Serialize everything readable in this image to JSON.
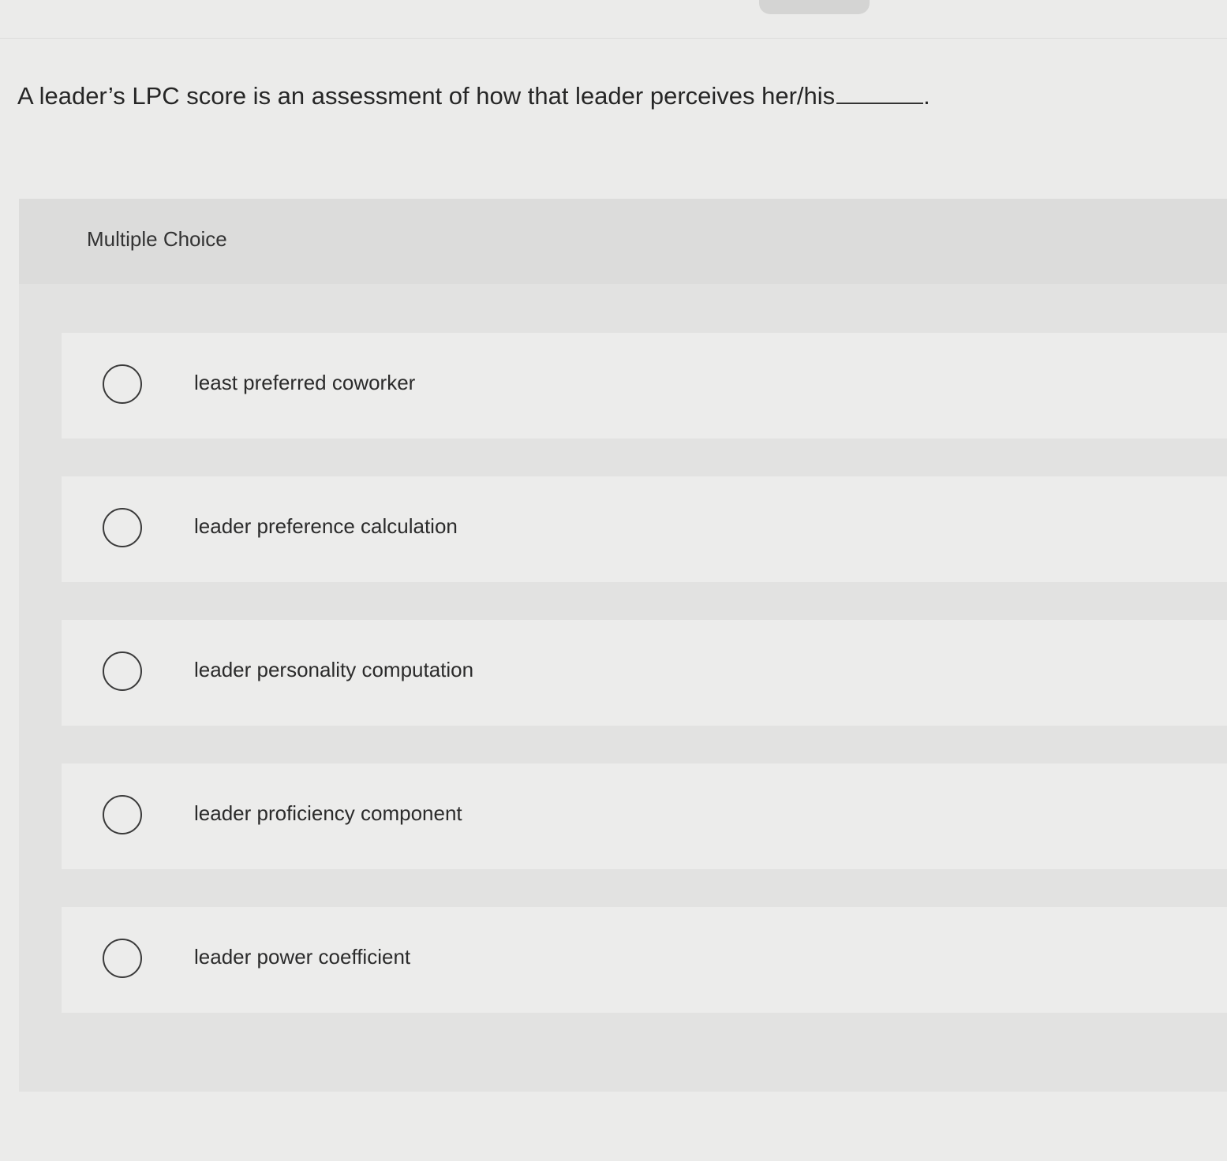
{
  "question": {
    "text": "A leader’s LPC score is an assessment of how that leader perceives her/his",
    "suffix": "."
  },
  "multiple_choice": {
    "title": "Multiple Choice",
    "options": [
      {
        "label": "least preferred coworker",
        "selected": false
      },
      {
        "label": "leader preference calculation",
        "selected": false
      },
      {
        "label": "leader personality computation",
        "selected": false
      },
      {
        "label": "leader proficiency component",
        "selected": false
      },
      {
        "label": "leader power coefficient",
        "selected": false
      }
    ]
  },
  "icons": {
    "option_marker": "radio-circle-icon"
  }
}
